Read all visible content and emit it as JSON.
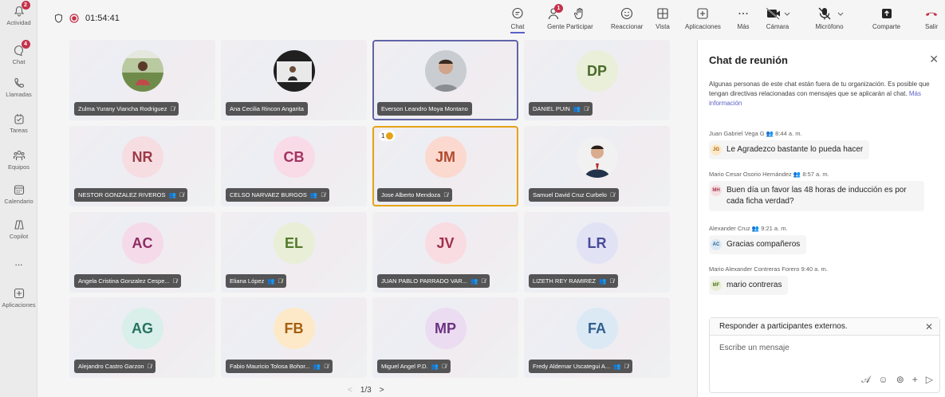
{
  "rail": {
    "items": [
      {
        "label": "Actividad",
        "badge": "2",
        "icon": "bell-icon"
      },
      {
        "label": "Chat",
        "badge": "4",
        "icon": "chat-icon"
      },
      {
        "label": "Llamadas",
        "badge": "",
        "icon": "phone-icon"
      },
      {
        "label": "Tareas",
        "badge": "",
        "icon": "tasks-icon"
      },
      {
        "label": "Equipos",
        "badge": "",
        "icon": "teams-icon"
      },
      {
        "label": "Calendario",
        "badge": "",
        "icon": "calendar-icon"
      },
      {
        "label": "Copilot",
        "badge": "",
        "icon": "copilot-icon"
      },
      {
        "label": "...",
        "badge": "",
        "icon": "more-icon"
      },
      {
        "label": "Aplicaciones",
        "badge": "",
        "icon": "add-apps-icon"
      }
    ]
  },
  "topbar": {
    "timer": "01:54:41",
    "buttons": [
      {
        "label": "Chat",
        "icon": "chat-icon",
        "badge": ""
      },
      {
        "label": "Gente",
        "icon": "people-icon",
        "badge": "1"
      },
      {
        "label": "Participar",
        "icon": "hand-icon",
        "badge": ""
      },
      {
        "label": "Reaccionar",
        "icon": "emoji-icon",
        "badge": ""
      },
      {
        "label": "Vista",
        "icon": "grid-icon",
        "badge": ""
      },
      {
        "label": "Aplicaciones",
        "icon": "add-icon",
        "badge": ""
      },
      {
        "label": "Más",
        "icon": "more-icon",
        "badge": ""
      },
      {
        "label": "Cámara",
        "icon": "camera-off-icon",
        "badge": ""
      },
      {
        "label": "Micrófono",
        "icon": "mic-off-icon",
        "badge": ""
      },
      {
        "label": "Comparte",
        "icon": "share-icon",
        "badge": ""
      },
      {
        "label": "Salir",
        "icon": "hangup-icon",
        "badge": ""
      }
    ]
  },
  "participants": [
    {
      "name": "Zulma Yurany Viancha Rodriguez",
      "initials": "",
      "photo": true,
      "host": false
    },
    {
      "name": "Ana Cecilia Rincon Angarita",
      "initials": "",
      "photo": true,
      "host": false
    },
    {
      "name": "Everson Leandro Moya Montano",
      "initials": "",
      "photo": true,
      "host": false
    },
    {
      "name": "DANIEL PUIN",
      "initials": "DP",
      "photo": false,
      "host": true
    },
    {
      "name": "NESTOR GONZALEZ RIVEROS",
      "initials": "NR",
      "photo": false,
      "host": true
    },
    {
      "name": "CELSO NARVAEZ BURGOS",
      "initials": "CB",
      "photo": false,
      "host": true
    },
    {
      "name": "Jose Alberto Mendoza",
      "initials": "JM",
      "photo": false,
      "host": false
    },
    {
      "name": "Samuel David Cruz Curbelo",
      "initials": "",
      "photo": true,
      "host": false
    },
    {
      "name": "Angela Cristina Gonzalez Cespe...",
      "initials": "AC",
      "photo": false,
      "host": false
    },
    {
      "name": "Eliana López",
      "initials": "EL",
      "photo": false,
      "host": true
    },
    {
      "name": "JUAN PABLO PARRADO VAR...",
      "initials": "JV",
      "photo": false,
      "host": true
    },
    {
      "name": "LIZETH REY RAMIREZ",
      "initials": "LR",
      "photo": false,
      "host": true
    },
    {
      "name": "Alejandro Castro Garzon",
      "initials": "AG",
      "photo": false,
      "host": false
    },
    {
      "name": "Fabio Mauricio Tolosa Bohor...",
      "initials": "FB",
      "photo": false,
      "host": true
    },
    {
      "name": "Miguel Angel P.D.",
      "initials": "MP",
      "photo": false,
      "host": true
    },
    {
      "name": "Fredy Aldemar Uscategui A...",
      "initials": "FA",
      "photo": false,
      "host": true
    }
  ],
  "hand_raise": {
    "order": "1"
  },
  "pager": {
    "label": "1/3"
  },
  "chat": {
    "title": "Chat de reunión",
    "notice": "Algunas personas de este chat están fuera de tu organización. Es posible que tengan directivas relacionadas con mensajes que se aplicarán al chat.",
    "notice_link": "Más información",
    "messages": [
      {
        "author": "Juan Gabriel Vega G",
        "time": "8:44 a. m.",
        "initials": "JG",
        "text": "Le Agradezco bastante lo pueda hacer"
      },
      {
        "author": "Mario Cesar Osorio Hernández",
        "time": "8:57 a. m.",
        "initials": "MH",
        "text": "Buen día un favor las 48 horas de inducción es por cada ficha verdad?"
      },
      {
        "author": "Alexander Cruz",
        "time": "9:21 a. m.",
        "initials": "AC",
        "text": "Gracias compañeros"
      },
      {
        "author": "Mario Alexander Contreras Forero",
        "time": "9:40 a. m.",
        "initials": "MF",
        "text": "mario contreras"
      }
    ],
    "external_header": "Responder a participantes externos.",
    "compose_placeholder": "Escribe un mensaje"
  },
  "colors": {
    "accent": "#5b5fc7",
    "badge": "#c4314b",
    "hand": "#e6a317",
    "hangup": "#c4314b"
  }
}
